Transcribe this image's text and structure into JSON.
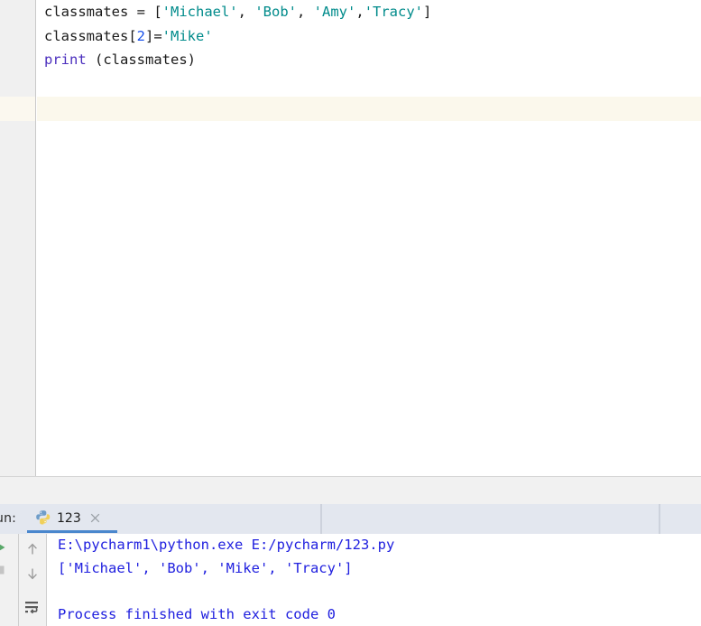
{
  "editor": {
    "language": "python",
    "lines": [
      {
        "index": 1,
        "text": "classmates = ['Michael', 'Bob', 'Amy','Tracy']",
        "tokens": [
          {
            "t": "classmates = [",
            "k": "plain"
          },
          {
            "t": "'Michael'",
            "k": "str"
          },
          {
            "t": ", ",
            "k": "plain"
          },
          {
            "t": "'Bob'",
            "k": "str"
          },
          {
            "t": ", ",
            "k": "plain"
          },
          {
            "t": "'Amy'",
            "k": "str"
          },
          {
            "t": ",",
            "k": "plain"
          },
          {
            "t": "'Tracy'",
            "k": "str"
          },
          {
            "t": "]",
            "k": "plain"
          }
        ]
      },
      {
        "index": 2,
        "text": "classmates[2]='Mike'",
        "tokens": [
          {
            "t": "classmates[",
            "k": "plain"
          },
          {
            "t": "2",
            "k": "num"
          },
          {
            "t": "]=",
            "k": "plain"
          },
          {
            "t": "'Mike'",
            "k": "str"
          }
        ]
      },
      {
        "index": 3,
        "text": "print (classmates)",
        "tokens": [
          {
            "t": "print",
            "k": "builtin"
          },
          {
            "t": " (classmates)",
            "k": "plain"
          }
        ]
      }
    ],
    "caret_line_index": 4
  },
  "run_window": {
    "label": "un:",
    "tab": {
      "title": "123",
      "icon": "python-icon",
      "close_icon": "close-icon",
      "active": true
    },
    "toolbar": {
      "run_icon": "run-icon",
      "stop_icon": "stop-icon",
      "more_icon": "more-icon",
      "up_icon": "arrow-up-icon",
      "down_icon": "arrow-down-icon",
      "softwrap_icon": "soft-wrap-icon"
    },
    "console": {
      "lines": [
        "E:\\pycharm1\\python.exe E:/pycharm/123.py",
        "['Michael', 'Bob', 'Mike', 'Tracy']",
        "",
        "Process finished with exit code 0"
      ]
    }
  },
  "colors": {
    "string": "#008b8b",
    "number": "#1750eb",
    "builtin": "#4b2fbe",
    "plain_code": "#1a1a1a",
    "console_text": "#2020df",
    "caret_line": "#fbf8ec",
    "gutter": "#f0f0f0",
    "tabbar": "#e3e7ef",
    "tab_underline": "#4a87cd"
  }
}
